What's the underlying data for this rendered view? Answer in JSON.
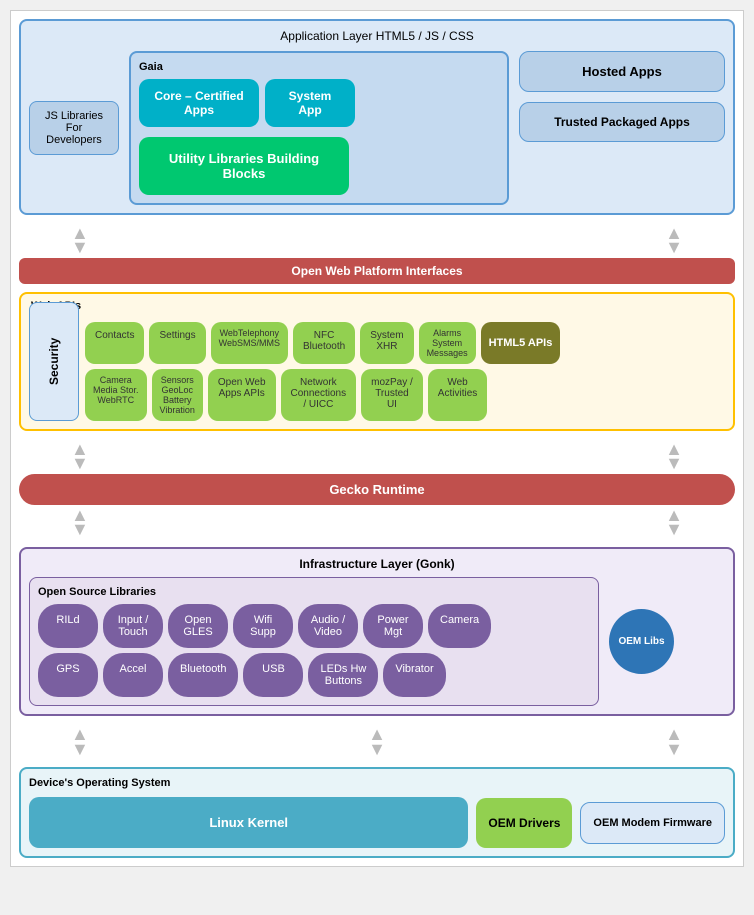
{
  "appLayer": {
    "title": "Application Layer",
    "subtitle": "HTML5 / JS / CSS",
    "gaia": {
      "label": "Gaia",
      "coreCertified": "Core – Certified Apps",
      "systemApp": "System App",
      "utilityLib": "Utility Libraries Building Blocks"
    },
    "jsLib": "JS Libraries For Developers",
    "hostedApps": "Hosted  Apps",
    "trustedApps": "Trusted Packaged Apps"
  },
  "owp": {
    "title": "Open Web Platform Interfaces"
  },
  "webApis": {
    "label": "Web APIs",
    "security": "Security",
    "apis": [
      {
        "label": "Contacts"
      },
      {
        "label": "Settings"
      },
      {
        "label": "WebTelephony WebSMS/MMS"
      },
      {
        "label": "NFC Bluetooth"
      },
      {
        "label": "System XHR"
      },
      {
        "label": "Alarms System Messages"
      },
      {
        "label": "Camera Media Stor. WebRTC"
      },
      {
        "label": "Sensors GeoLoc Battery Vibration"
      },
      {
        "label": "Open Web Apps APIs"
      },
      {
        "label": "Network Connections / UICC"
      },
      {
        "label": "mozPay / Trusted UI"
      },
      {
        "label": "Web Activities"
      }
    ],
    "html5": "HTML5 APIs"
  },
  "gecko": {
    "title": "Gecko Runtime"
  },
  "infraLayer": {
    "title": "Infrastructure Layer (Gonk)",
    "openSource": {
      "label": "Open Source Libraries",
      "libs": [
        "RILd",
        "Input / Touch",
        "Open GLES",
        "Wifi Supp",
        "Audio / Video",
        "Power Mgt",
        "Camera",
        "GPS",
        "Accel",
        "Bluetooth",
        "USB",
        "LEDs Hw Buttons",
        "Vibrator"
      ]
    },
    "oemLibs": "OEM Libs"
  },
  "deviceOS": {
    "title": "Device's Operating System",
    "linux": "Linux Kernel",
    "oemDrivers": "OEM Drivers",
    "oemModem": "OEM Modem Firmware"
  }
}
